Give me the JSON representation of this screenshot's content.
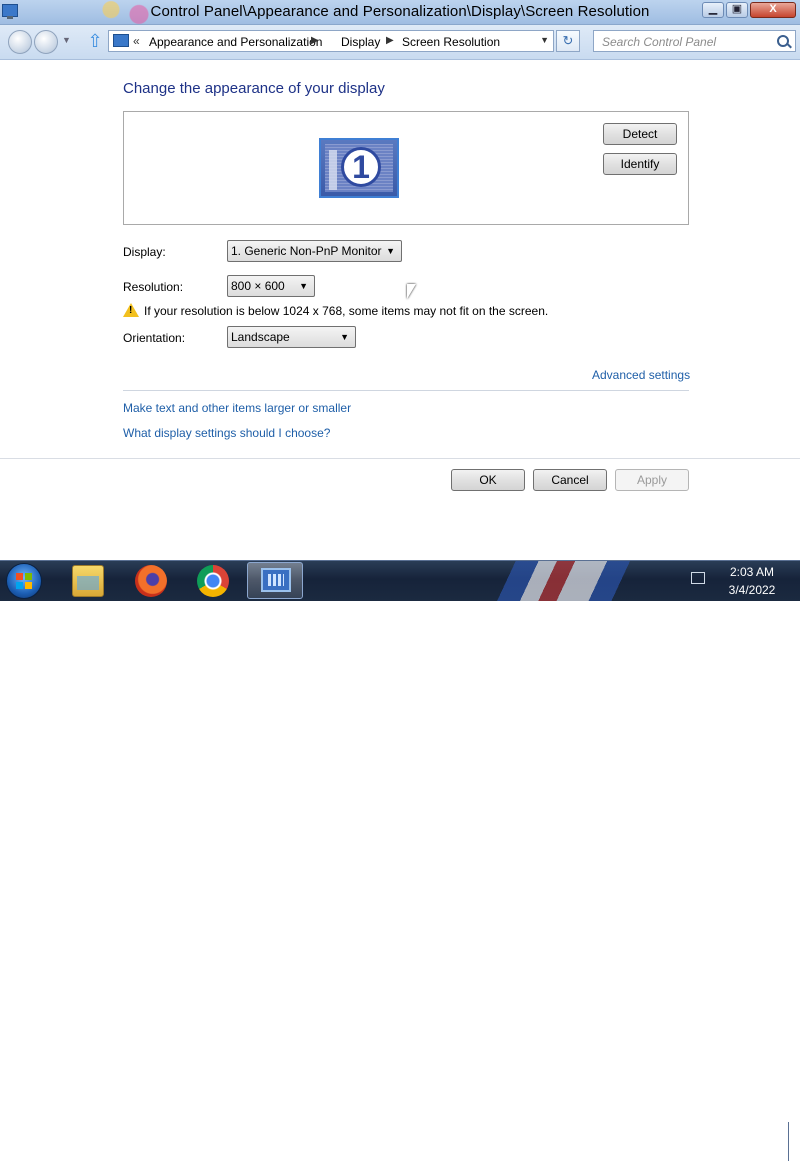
{
  "window": {
    "title": "Control Panel\\Appearance and Personalization\\Display\\Screen Resolution",
    "minimize_glyph": "▁",
    "maximize_glyph": "▣",
    "close_glyph": "X"
  },
  "address_bar": {
    "chevron": "«",
    "breadcrumbs": [
      "Appearance and Personalization",
      "Display",
      "Screen Resolution"
    ],
    "separator": "▶",
    "dropdown_glyph": "▼",
    "refresh_glyph": "↻"
  },
  "search": {
    "placeholder": "Search Control Panel"
  },
  "main": {
    "heading": "Change the appearance of your display",
    "monitor_number": "1",
    "detect_label": "Detect",
    "identify_label": "Identify",
    "display_label": "Display:",
    "display_value": "1. Generic Non-PnP Monitor",
    "resolution_label": "Resolution:",
    "resolution_value": "800 × 600",
    "warning_text": "If your resolution is below 1024 x 768, some items may not fit on the screen.",
    "orientation_label": "Orientation:",
    "orientation_value": "Landscape",
    "advanced_link": "Advanced settings",
    "link_text_size": "Make text and other items larger or smaller",
    "link_help": "What display settings should I choose?",
    "ok_label": "OK",
    "cancel_label": "Cancel",
    "apply_label": "Apply",
    "dropdown_arrow": "▼"
  },
  "taskbar": {
    "time": "2:03 AM",
    "date": "3/4/2022"
  },
  "icons": {
    "start": "windows-start-orb",
    "explorer": "folder-icon",
    "firefox": "firefox-icon",
    "chrome": "chrome-icon",
    "control_panel": "control-panel-icon",
    "network": "network-icon",
    "warning": "warning-icon"
  }
}
